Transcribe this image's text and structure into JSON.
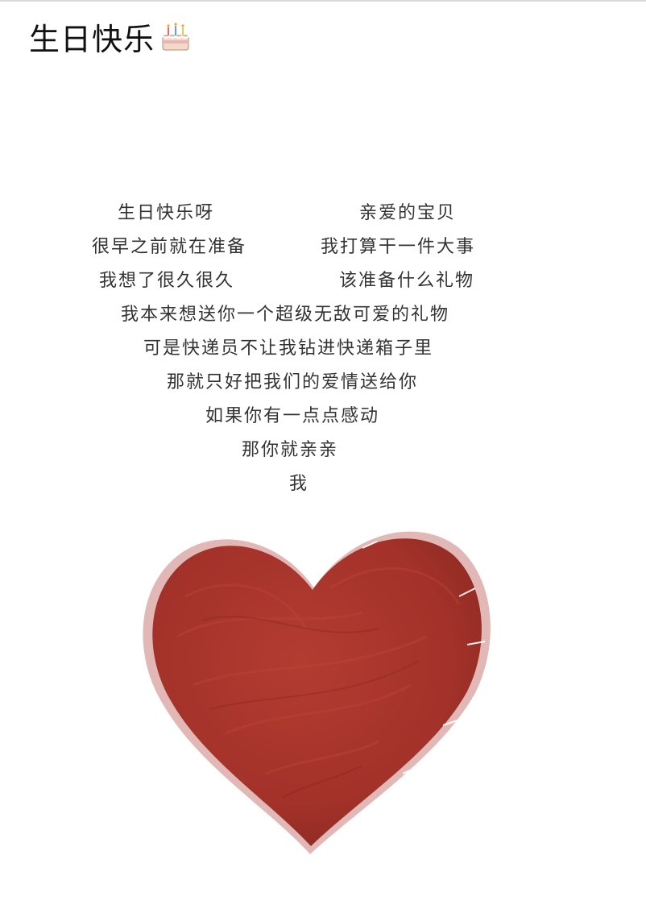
{
  "post": {
    "title": "生日快乐",
    "title_emoji": "cake-icon"
  },
  "poem": {
    "lines": [
      "生日快乐呀",
      "亲爱的宝贝",
      "很早之前就在准备",
      "我打算干一件大事",
      "我想了很久很久",
      "该准备什么礼物",
      "我本来想送你一个超级无敌可爱的礼物",
      "可是快递员不让我钻进快递箱子里",
      "那就只好把我们的爱情送给你",
      "如果你有一点点感动",
      "那你就亲亲",
      "我"
    ]
  },
  "colors": {
    "heart": "#a9352a",
    "text": "#333333"
  }
}
